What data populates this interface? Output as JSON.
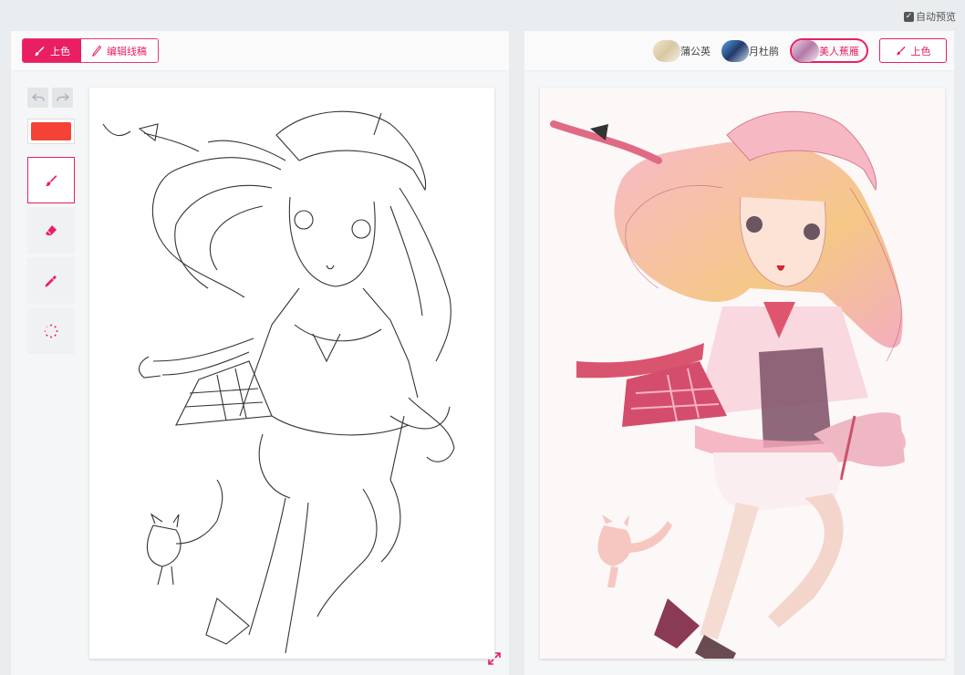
{
  "auto_preview": {
    "label": "自动预览",
    "checked": true
  },
  "left_panel": {
    "tabs": [
      {
        "label": "上色",
        "active": true,
        "icon": "brush-icon"
      },
      {
        "label": "编辑线稿",
        "active": false,
        "icon": "pencil-icon"
      }
    ],
    "tools": {
      "current_color": "#f44336",
      "items": [
        {
          "name": "brush",
          "icon": "brush-icon",
          "selected": true
        },
        {
          "name": "eraser",
          "icon": "eraser-icon",
          "selected": false
        },
        {
          "name": "eyedropper",
          "icon": "eyedropper-icon",
          "selected": false
        },
        {
          "name": "loading",
          "icon": "spinner-icon",
          "selected": false
        }
      ]
    }
  },
  "right_panel": {
    "styles": [
      {
        "label": "蒲公英",
        "selected": false
      },
      {
        "label": "月杜鹃",
        "selected": false
      },
      {
        "label": "美人蕉雁",
        "selected": true
      }
    ],
    "colorize_button": "上色"
  },
  "colors": {
    "accent": "#e91e63",
    "brush": "#f44336"
  }
}
